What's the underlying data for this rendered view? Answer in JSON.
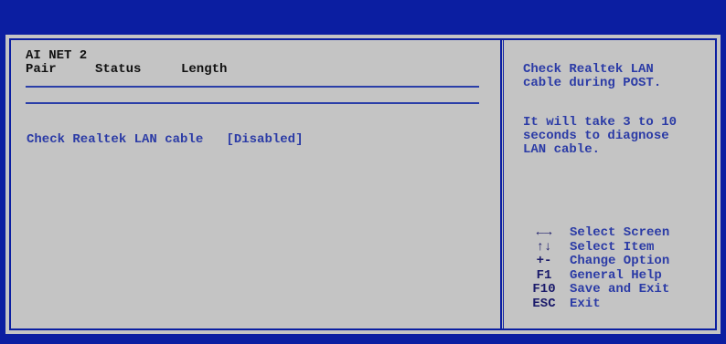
{
  "section": {
    "title": "AI NET 2",
    "columns": [
      "Pair",
      "Status",
      "Length"
    ]
  },
  "setting": {
    "label": "Check Realtek LAN cable",
    "value": "[Disabled]"
  },
  "help": {
    "paragraphs": [
      "Check Realtek LAN\ncable during POST.",
      "It will take 3 to 10\nseconds to diagnose\nLAN cable."
    ]
  },
  "keys": [
    {
      "key": "←→",
      "desc": "Select Screen"
    },
    {
      "key": "↑↓",
      "desc": "Select Item"
    },
    {
      "key": "+-",
      "desc": "Change Option"
    },
    {
      "key": "F1",
      "desc": "General Help"
    },
    {
      "key": "F10",
      "desc": "Save and Exit"
    },
    {
      "key": "ESC",
      "desc": "Exit"
    }
  ]
}
